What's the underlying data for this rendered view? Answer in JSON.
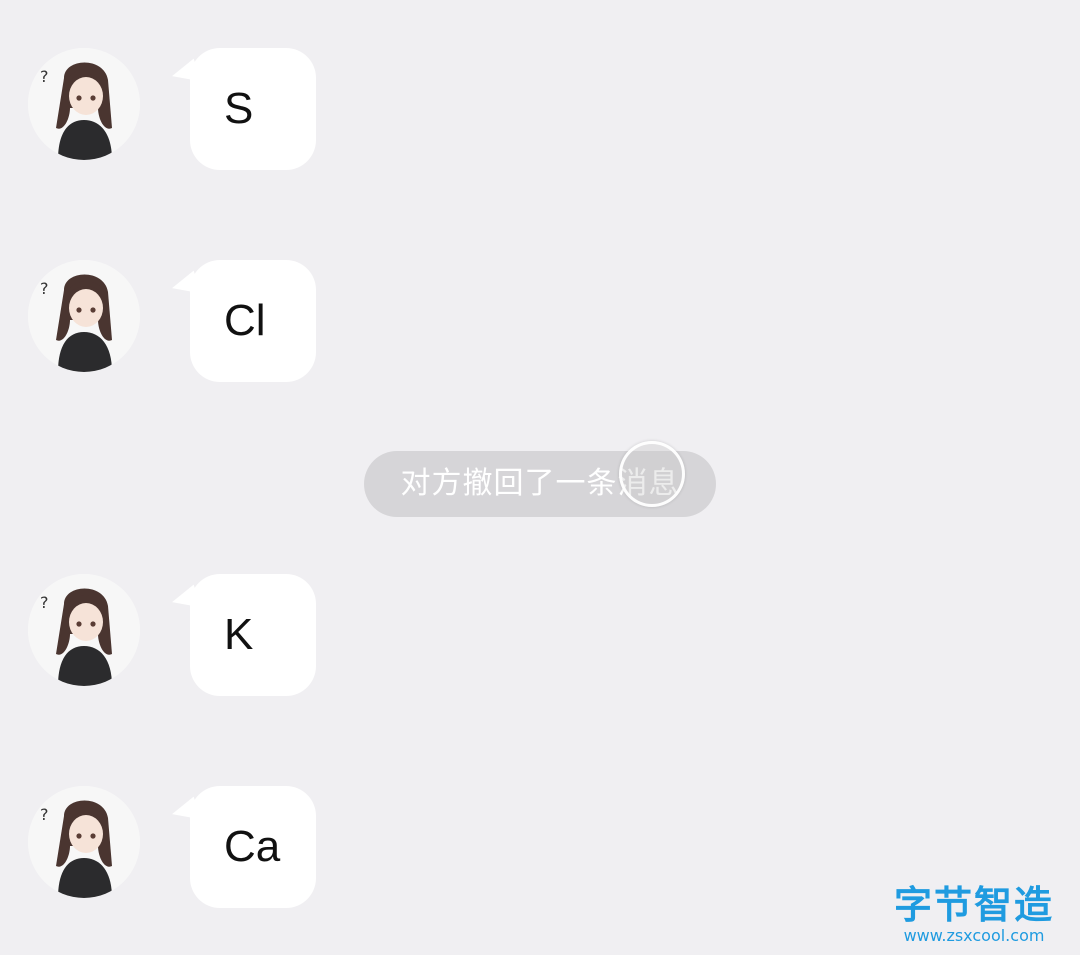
{
  "chat": {
    "messages": [
      {
        "sender": "contact",
        "text": "S"
      },
      {
        "sender": "contact",
        "text": "Cl"
      },
      {
        "sender": "contact",
        "text": "K"
      },
      {
        "sender": "contact",
        "text": "Ca"
      }
    ],
    "system_notice": "对方撤回了一条消息"
  },
  "watermark": {
    "logo": "字节智造",
    "url": "www.zsxcool.com"
  },
  "colors": {
    "background": "#f0eff2",
    "bubble": "#ffffff",
    "notice_bg": "#d6d5d8",
    "watermark": "#1f9be0"
  }
}
